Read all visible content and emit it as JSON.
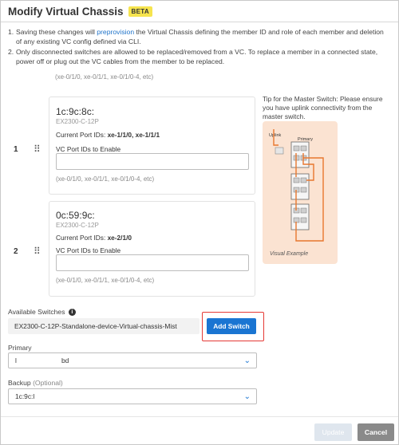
{
  "modal": {
    "title": "Modify Virtual Chassis",
    "badge": "BETA"
  },
  "notes": {
    "n1_num": "1.",
    "n1_pre": "Saving these changes will ",
    "n1_link": "preprovision",
    "n1_post": " the Virtual Chassis defining the member ID and role of each member and deletion of any existing VC config defined via CLI.",
    "n2_num": "2.",
    "n2_text": "Only disconnected switches are allowed to be replaced/removed from a VC. To replace a member in a connected state, power off or plug out the VC cables from the member to be replaced."
  },
  "members": {
    "top_hint": "(xe-0/1/0, xe-0/1/1, xe-0/1/0-4, etc)",
    "m1": {
      "index": "1",
      "mac": "1c:9c:8c:",
      "model": "EX2300-C-12P",
      "ports_label": "Current Port IDs: ",
      "ports_value": "xe-1/1/0, xe-1/1/1",
      "vc_label": "VC Port IDs to Enable",
      "vc_value": "",
      "hint": "(xe-0/1/0, xe-0/1/1, xe-0/1/0-4, etc)"
    },
    "m2": {
      "index": "2",
      "mac": "0c:59:9c:",
      "model": "EX2300-C-12P",
      "ports_label": "Current Port IDs: ",
      "ports_value": "xe-2/1/0",
      "vc_label": "VC Port IDs to Enable",
      "vc_value": "",
      "hint": "(xe-0/1/0, xe-0/1/1, xe-0/1/0-4, etc)"
    }
  },
  "tip": {
    "text": "Tip for the Master Switch: Please ensure you have uplink connectivity from the master switch.",
    "uplink": "Uplink",
    "primary": "Primary",
    "caption": "Visual Example",
    "accent": "#e8772e"
  },
  "available": {
    "label": "Available Switches",
    "value": "EX2300-C-12P-Standalone-device-Virtual-chassis-Mist",
    "add_button": "Add Switch"
  },
  "primary": {
    "label": "Primary",
    "value_a": "l",
    "value_b": "bd"
  },
  "backup": {
    "label": "Backup",
    "optional": "(Optional)",
    "value": "1c:9c:l"
  },
  "footer": {
    "update": "Update",
    "cancel": "Cancel"
  },
  "colors": {
    "primary_blue": "#1a75d2",
    "highlight_red": "#e53935",
    "beta_yellow": "#f6e44e"
  }
}
